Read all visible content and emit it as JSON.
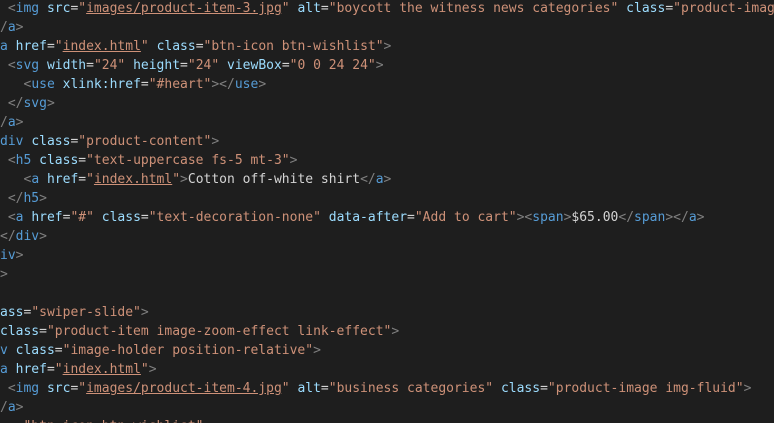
{
  "editor": {
    "theme_colors": {
      "background": "#1e1e1e",
      "punctuation": "#808080",
      "tag": "#569cd6",
      "attribute": "#9cdcfe",
      "string": "#ce9178",
      "text": "#d4d4d4"
    },
    "lines": [
      {
        "indent": " ",
        "tokens": [
          {
            "k": "punct",
            "v": "<"
          },
          {
            "k": "tag",
            "v": "img"
          },
          {
            "k": "text",
            "v": " "
          },
          {
            "k": "attr",
            "v": "src"
          },
          {
            "k": "eq",
            "v": "="
          },
          {
            "k": "str",
            "v": "\""
          },
          {
            "k": "link",
            "v": "images/product-item-3.jpg"
          },
          {
            "k": "str",
            "v": "\""
          },
          {
            "k": "text",
            "v": " "
          },
          {
            "k": "attr",
            "v": "alt"
          },
          {
            "k": "eq",
            "v": "="
          },
          {
            "k": "str",
            "v": "\"boycott the witness news categories\""
          },
          {
            "k": "text",
            "v": " "
          },
          {
            "k": "attr",
            "v": "class"
          },
          {
            "k": "eq",
            "v": "="
          },
          {
            "k": "str",
            "v": "\"product-image"
          }
        ]
      },
      {
        "indent": "",
        "tokens": [
          {
            "k": "punct",
            "v": "/"
          },
          {
            "k": "tag",
            "v": "a"
          },
          {
            "k": "punct",
            "v": ">"
          }
        ]
      },
      {
        "indent": "",
        "tokens": [
          {
            "k": "tag",
            "v": "a"
          },
          {
            "k": "text",
            "v": " "
          },
          {
            "k": "attr",
            "v": "href"
          },
          {
            "k": "eq",
            "v": "="
          },
          {
            "k": "str",
            "v": "\""
          },
          {
            "k": "link",
            "v": "index.html"
          },
          {
            "k": "str",
            "v": "\""
          },
          {
            "k": "text",
            "v": " "
          },
          {
            "k": "attr",
            "v": "class"
          },
          {
            "k": "eq",
            "v": "="
          },
          {
            "k": "str",
            "v": "\"btn-icon btn-wishlist\""
          },
          {
            "k": "punct",
            "v": ">"
          }
        ]
      },
      {
        "indent": " ",
        "tokens": [
          {
            "k": "punct",
            "v": "<"
          },
          {
            "k": "tag",
            "v": "svg"
          },
          {
            "k": "text",
            "v": " "
          },
          {
            "k": "attr",
            "v": "width"
          },
          {
            "k": "eq",
            "v": "="
          },
          {
            "k": "str",
            "v": "\"24\""
          },
          {
            "k": "text",
            "v": " "
          },
          {
            "k": "attr",
            "v": "height"
          },
          {
            "k": "eq",
            "v": "="
          },
          {
            "k": "str",
            "v": "\"24\""
          },
          {
            "k": "text",
            "v": " "
          },
          {
            "k": "attr",
            "v": "viewBox"
          },
          {
            "k": "eq",
            "v": "="
          },
          {
            "k": "str",
            "v": "\"0 0 24 24\""
          },
          {
            "k": "punct",
            "v": ">"
          }
        ]
      },
      {
        "indent": "   ",
        "tokens": [
          {
            "k": "punct",
            "v": "<"
          },
          {
            "k": "tag",
            "v": "use"
          },
          {
            "k": "text",
            "v": " "
          },
          {
            "k": "attr",
            "v": "xlink:href"
          },
          {
            "k": "eq",
            "v": "="
          },
          {
            "k": "str",
            "v": "\"#heart\""
          },
          {
            "k": "punct",
            "v": "></"
          },
          {
            "k": "tag",
            "v": "use"
          },
          {
            "k": "punct",
            "v": ">"
          }
        ]
      },
      {
        "indent": " ",
        "tokens": [
          {
            "k": "punct",
            "v": "</"
          },
          {
            "k": "tag",
            "v": "svg"
          },
          {
            "k": "punct",
            "v": ">"
          }
        ]
      },
      {
        "indent": "",
        "tokens": [
          {
            "k": "punct",
            "v": "/"
          },
          {
            "k": "tag",
            "v": "a"
          },
          {
            "k": "punct",
            "v": ">"
          }
        ]
      },
      {
        "indent": "",
        "tokens": [
          {
            "k": "tag",
            "v": "div"
          },
          {
            "k": "text",
            "v": " "
          },
          {
            "k": "attr",
            "v": "class"
          },
          {
            "k": "eq",
            "v": "="
          },
          {
            "k": "str",
            "v": "\"product-content\""
          },
          {
            "k": "punct",
            "v": ">"
          }
        ]
      },
      {
        "indent": " ",
        "tokens": [
          {
            "k": "punct",
            "v": "<"
          },
          {
            "k": "tag",
            "v": "h5"
          },
          {
            "k": "text",
            "v": " "
          },
          {
            "k": "attr",
            "v": "class"
          },
          {
            "k": "eq",
            "v": "="
          },
          {
            "k": "str",
            "v": "\"text-uppercase fs-5 mt-3\""
          },
          {
            "k": "punct",
            "v": ">"
          }
        ]
      },
      {
        "indent": "   ",
        "tokens": [
          {
            "k": "punct",
            "v": "<"
          },
          {
            "k": "tag",
            "v": "a"
          },
          {
            "k": "text",
            "v": " "
          },
          {
            "k": "attr",
            "v": "href"
          },
          {
            "k": "eq",
            "v": "="
          },
          {
            "k": "str",
            "v": "\""
          },
          {
            "k": "link",
            "v": "index.html"
          },
          {
            "k": "str",
            "v": "\""
          },
          {
            "k": "punct",
            "v": ">"
          },
          {
            "k": "text",
            "v": "Cotton off-white shirt"
          },
          {
            "k": "punct",
            "v": "</"
          },
          {
            "k": "tag",
            "v": "a"
          },
          {
            "k": "punct",
            "v": ">"
          }
        ]
      },
      {
        "indent": " ",
        "tokens": [
          {
            "k": "punct",
            "v": "</"
          },
          {
            "k": "tag",
            "v": "h5"
          },
          {
            "k": "punct",
            "v": ">"
          }
        ]
      },
      {
        "indent": " ",
        "tokens": [
          {
            "k": "punct",
            "v": "<"
          },
          {
            "k": "tag",
            "v": "a"
          },
          {
            "k": "text",
            "v": " "
          },
          {
            "k": "attr",
            "v": "href"
          },
          {
            "k": "eq",
            "v": "="
          },
          {
            "k": "str",
            "v": "\"#\""
          },
          {
            "k": "text",
            "v": " "
          },
          {
            "k": "attr",
            "v": "class"
          },
          {
            "k": "eq",
            "v": "="
          },
          {
            "k": "str",
            "v": "\"text-decoration-none\""
          },
          {
            "k": "text",
            "v": " "
          },
          {
            "k": "attr",
            "v": "data-after"
          },
          {
            "k": "eq",
            "v": "="
          },
          {
            "k": "str",
            "v": "\"Add to cart\""
          },
          {
            "k": "punct",
            "v": "><"
          },
          {
            "k": "tag",
            "v": "span"
          },
          {
            "k": "punct",
            "v": ">"
          },
          {
            "k": "text",
            "v": "$65.00"
          },
          {
            "k": "punct",
            "v": "</"
          },
          {
            "k": "tag",
            "v": "span"
          },
          {
            "k": "punct",
            "v": "></"
          },
          {
            "k": "tag",
            "v": "a"
          },
          {
            "k": "punct",
            "v": ">"
          }
        ]
      },
      {
        "indent": "",
        "tokens": [
          {
            "k": "punct",
            "v": "</"
          },
          {
            "k": "tag",
            "v": "div"
          },
          {
            "k": "punct",
            "v": ">"
          }
        ]
      },
      {
        "indent": "",
        "tokens": [
          {
            "k": "tag",
            "v": "iv"
          },
          {
            "k": "punct",
            "v": ">"
          }
        ]
      },
      {
        "indent": "",
        "tokens": [
          {
            "k": "punct",
            "v": ">"
          }
        ]
      },
      {
        "indent": "",
        "tokens": []
      },
      {
        "indent": "",
        "tokens": [
          {
            "k": "attr",
            "v": "ass"
          },
          {
            "k": "eq",
            "v": "="
          },
          {
            "k": "str",
            "v": "\"swiper-slide\""
          },
          {
            "k": "punct",
            "v": ">"
          }
        ]
      },
      {
        "indent": "",
        "tokens": [
          {
            "k": "attr",
            "v": "class"
          },
          {
            "k": "eq",
            "v": "="
          },
          {
            "k": "str",
            "v": "\"product-item image-zoom-effect link-effect\""
          },
          {
            "k": "punct",
            "v": ">"
          }
        ]
      },
      {
        "indent": "",
        "tokens": [
          {
            "k": "tag",
            "v": "v"
          },
          {
            "k": "text",
            "v": " "
          },
          {
            "k": "attr",
            "v": "class"
          },
          {
            "k": "eq",
            "v": "="
          },
          {
            "k": "str",
            "v": "\"image-holder position-relative\""
          },
          {
            "k": "punct",
            "v": ">"
          }
        ]
      },
      {
        "indent": "",
        "tokens": [
          {
            "k": "tag",
            "v": "a"
          },
          {
            "k": "text",
            "v": " "
          },
          {
            "k": "attr",
            "v": "href"
          },
          {
            "k": "eq",
            "v": "="
          },
          {
            "k": "str",
            "v": "\""
          },
          {
            "k": "link",
            "v": "index.html"
          },
          {
            "k": "str",
            "v": "\""
          },
          {
            "k": "punct",
            "v": ">"
          }
        ]
      },
      {
        "indent": " ",
        "tokens": [
          {
            "k": "punct",
            "v": "<"
          },
          {
            "k": "tag",
            "v": "img"
          },
          {
            "k": "text",
            "v": " "
          },
          {
            "k": "attr",
            "v": "src"
          },
          {
            "k": "eq",
            "v": "="
          },
          {
            "k": "str",
            "v": "\""
          },
          {
            "k": "link",
            "v": "images/product-item-4.jpg"
          },
          {
            "k": "str",
            "v": "\""
          },
          {
            "k": "text",
            "v": " "
          },
          {
            "k": "attr",
            "v": "alt"
          },
          {
            "k": "eq",
            "v": "="
          },
          {
            "k": "str",
            "v": "\"business categories\""
          },
          {
            "k": "text",
            "v": " "
          },
          {
            "k": "attr",
            "v": "class"
          },
          {
            "k": "eq",
            "v": "="
          },
          {
            "k": "str",
            "v": "\"product-image img-fluid\""
          },
          {
            "k": "punct",
            "v": ">"
          }
        ]
      },
      {
        "indent": "",
        "tokens": [
          {
            "k": "punct",
            "v": "/"
          },
          {
            "k": "tag",
            "v": "a"
          },
          {
            "k": "punct",
            "v": ">"
          }
        ]
      },
      {
        "indent": "",
        "tokens": [
          {
            "k": "str",
            "v": "  -\"btn-icon btn-wishlist\""
          }
        ]
      }
    ]
  }
}
